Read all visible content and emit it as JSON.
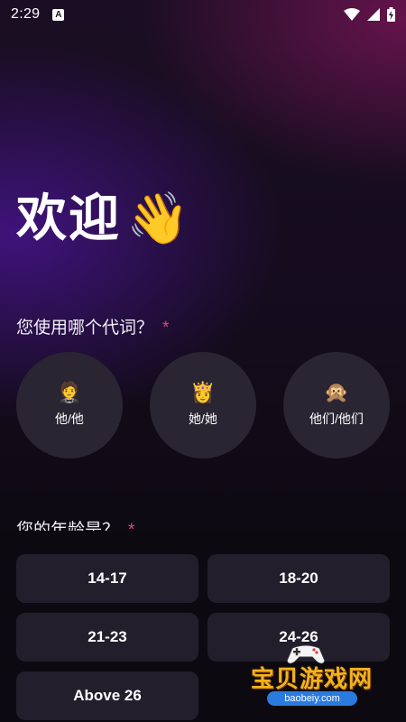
{
  "status_bar": {
    "time": "2:29",
    "notification_letter": "A",
    "icons": [
      "wifi-icon",
      "signal-icon",
      "battery-icon"
    ]
  },
  "welcome": {
    "title": "欢迎",
    "emoji": "👋"
  },
  "pronoun_question": {
    "label": "您使用哪个代词？",
    "required_mark": "*"
  },
  "pronouns": [
    {
      "emoji": "🤵",
      "label": "他/他"
    },
    {
      "emoji": "👸",
      "label": "她/她"
    },
    {
      "emoji": "🙊",
      "label": "他们/他们"
    }
  ],
  "age_question": {
    "label": "您的年龄是？",
    "required_mark": "*"
  },
  "age_options": [
    "14-17",
    "18-20",
    "21-23",
    "24-26",
    "Above 26"
  ],
  "watermark": {
    "text": "宝贝游戏网",
    "url": "baobeiy.com"
  },
  "colors": {
    "accent_star": "#e0457b",
    "card_bg": "#2a2532",
    "button_bg": "#221e2c",
    "watermark_gold": "#f2b21d"
  }
}
